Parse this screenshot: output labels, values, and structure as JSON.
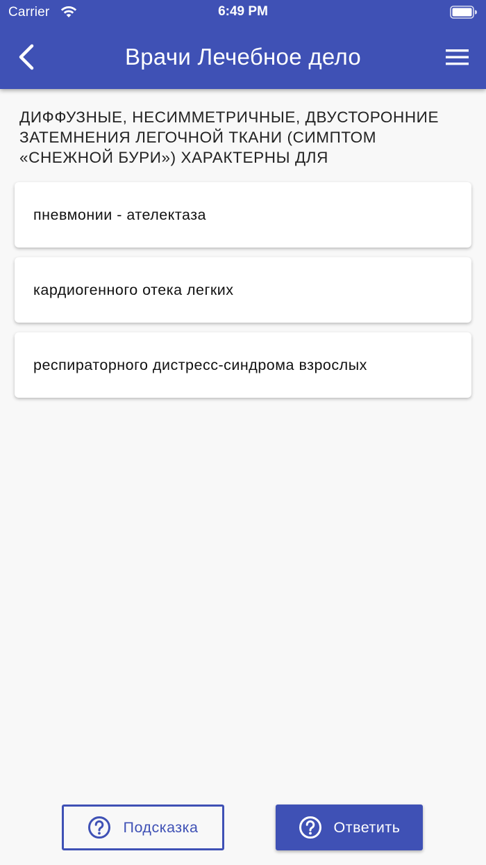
{
  "status_bar": {
    "carrier": "Carrier",
    "time": "6:49 PM"
  },
  "app_bar": {
    "title": "Врачи Лечебное дело",
    "color": "#3f51b5",
    "back_icon": "chevron-left-icon",
    "menu_icon": "hamburger-menu-icon"
  },
  "question": {
    "text": "ДИФФУЗНЫЕ, НЕСИММЕТРИЧНЫЕ, ДВУСТОРОННИЕ ЗАТЕМНЕНИЯ ЛЕГОЧНОЙ ТКАНИ (СИМПТОМ «СНЕЖНОЙ БУРИ») ХАРАКТЕРНЫ ДЛЯ"
  },
  "answers": [
    {
      "label": "пневмонии - ателектаза"
    },
    {
      "label": "кардиогенного отека легких"
    },
    {
      "label": "респираторного дистресс-синдрома взрослых"
    }
  ],
  "actions": {
    "hint_label": "Подсказка",
    "answer_label": "Ответить",
    "icon": "question-circle-icon"
  }
}
